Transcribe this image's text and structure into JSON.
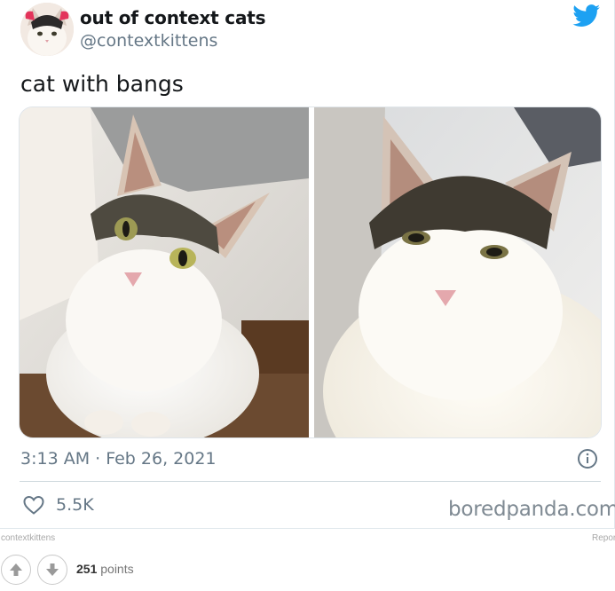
{
  "tweet": {
    "display_name": "out of context cats",
    "handle": "@contextkittens",
    "text": "cat with bangs",
    "timestamp": "3:13 AM · Feb 26, 2021",
    "likes": "5.5K",
    "icons": {
      "brand": "twitter-bird-icon",
      "info": "info-icon",
      "like": "heart-icon"
    },
    "colors": {
      "brand": "#1da1f2",
      "secondary_text": "#657786"
    }
  },
  "watermark": "boredpanda.com",
  "footer": {
    "source": "contextkittens",
    "report": "Report",
    "points_value": "251",
    "points_label": "points",
    "icons": {
      "upvote": "arrow-up-icon",
      "downvote": "arrow-down-icon"
    }
  }
}
